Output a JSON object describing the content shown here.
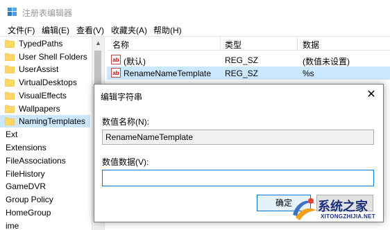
{
  "window": {
    "title": "注册表编辑器"
  },
  "menu": [
    {
      "label": "文件(F)"
    },
    {
      "label": "编辑(E)"
    },
    {
      "label": "查看(V)"
    },
    {
      "label": "收藏夹(A)"
    },
    {
      "label": "帮助(H)"
    }
  ],
  "tree": {
    "items": [
      {
        "label": "TypedPaths",
        "folder": true
      },
      {
        "label": "User Shell Folders",
        "folder": true
      },
      {
        "label": "UserAssist",
        "folder": true
      },
      {
        "label": "VirtualDesktops",
        "folder": true
      },
      {
        "label": "VisualEffects",
        "folder": true
      },
      {
        "label": "Wallpapers",
        "folder": true
      },
      {
        "label": "NamingTemplates",
        "folder": true,
        "selected": true
      },
      {
        "label": "Ext",
        "folder": false
      },
      {
        "label": "Extensions",
        "folder": false
      },
      {
        "label": "FileAssociations",
        "folder": false
      },
      {
        "label": "FileHistory",
        "folder": false
      },
      {
        "label": "GameDVR",
        "folder": false
      },
      {
        "label": "Group Policy",
        "folder": false
      },
      {
        "label": "HomeGroup",
        "folder": false
      },
      {
        "label": "ime",
        "folder": false
      }
    ]
  },
  "list": {
    "headers": {
      "name": "名称",
      "type": "类型",
      "data": "数据"
    },
    "rows": [
      {
        "icon": "ab",
        "name": "(默认)",
        "type": "REG_SZ",
        "data": "(数值未设置)",
        "selected": false
      },
      {
        "icon": "ab",
        "name": "RenameNameTemplate",
        "type": "REG_SZ",
        "data": "%s",
        "selected": true
      }
    ]
  },
  "dialog": {
    "title": "编辑字符串",
    "close_glyph": "✕",
    "name_label": "数值名称(N):",
    "name_value": "RenameNameTemplate",
    "data_label": "数值数据(V):",
    "data_value": "",
    "ok_label": "确定"
  },
  "watermark": {
    "text": "系统之家",
    "url": "XITONGZHIJIA.NET"
  },
  "colors": {
    "selection": "#cce8ff",
    "accent": "#0078d7",
    "folder": "#ffd766"
  }
}
